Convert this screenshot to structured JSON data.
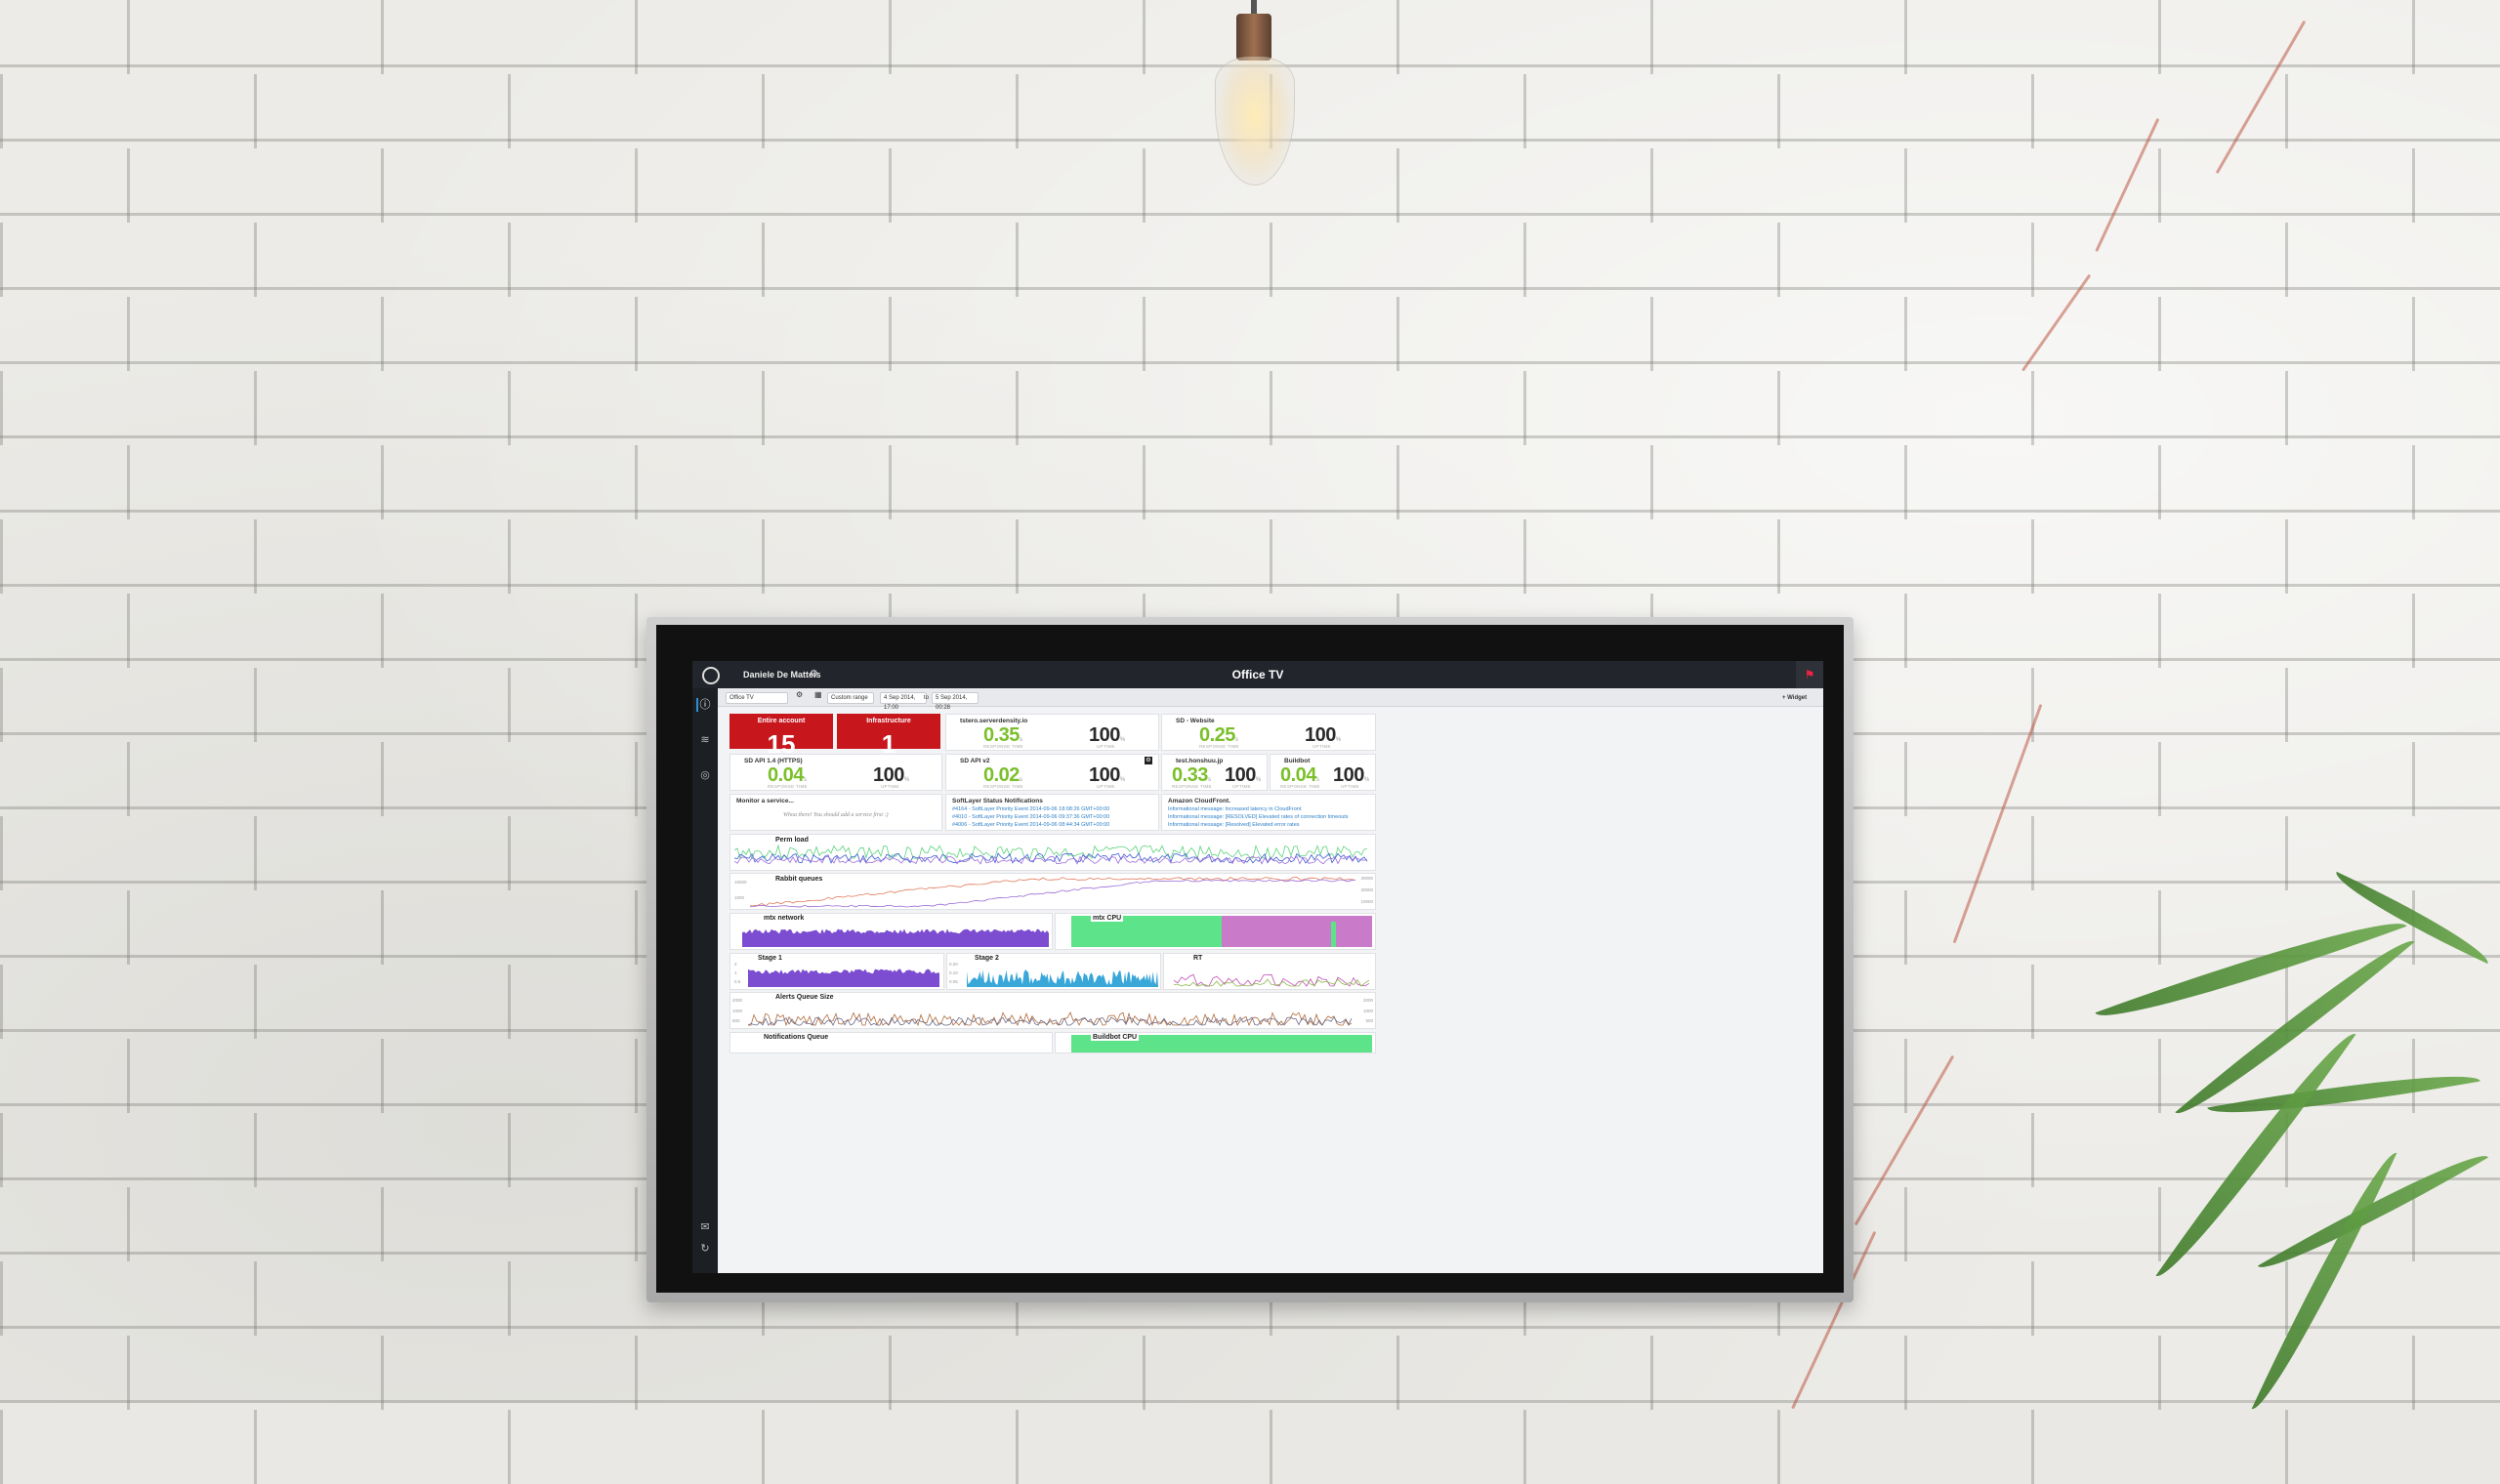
{
  "screen": {
    "user": "Daniele De Mattéis",
    "title": "Office TV",
    "dashboard_select": "Office TV",
    "range_select": "Custom range",
    "range_start": "4 Sep 2014, 17:00",
    "range_to": "to",
    "range_end": "5 Sep 2014, 00:28",
    "add_widget": "+ Widget"
  },
  "alerts": [
    {
      "label": "Entire account",
      "value": "15"
    },
    {
      "label": "Infrastructure",
      "value": "1"
    }
  ],
  "services": [
    {
      "name": "tstero.serverdensity.io",
      "response": "0.35",
      "uptime": "100"
    },
    {
      "name": "SD - Website",
      "response": "0.25",
      "uptime": "100"
    },
    {
      "name": "SD API 1.4 (HTTPS)",
      "response": "0.04",
      "uptime": "100"
    },
    {
      "name": "SD API v2",
      "response": "0.02",
      "uptime": "100"
    },
    {
      "name": "test.honshuu.jp",
      "response": "0.33",
      "uptime": "100"
    },
    {
      "name": "Buildbot",
      "response": "0.04",
      "uptime": "100"
    }
  ],
  "units": {
    "response": "s",
    "uptime": "%",
    "response_label": "RESPONSE TIME",
    "uptime_label": "UPTIME"
  },
  "monitor": {
    "title": "Monitor a service...",
    "hint": "Whoa there! You should add a service first :)"
  },
  "feeds": [
    {
      "title": "SoftLayer Status Notifications",
      "items": [
        "#4164 - SoftLayer Priority Event 2014-09-06 18:08:26 GMT+00:00",
        "#4010 - SoftLayer Priority Event 2014-09-06 09:37:36 GMT+00:00",
        "#4006 - SoftLayer Priority Event 2014-09-06 08:44:34 GMT+00:00"
      ]
    },
    {
      "title": "Amazon CloudFront.",
      "items": [
        "Informational message: Increased latency in CloudFront",
        "Informational message: [RESOLVED] Elevated rates of connection timeouts",
        "Informational message: [Resolved] Elevated error rates"
      ]
    }
  ],
  "charts": [
    {
      "title": "Perm load"
    },
    {
      "title": "Rabbit queues"
    },
    {
      "title": "mtx network"
    },
    {
      "title": "mtx CPU"
    },
    {
      "title": "Stage 1"
    },
    {
      "title": "Stage 2"
    },
    {
      "title": "RT"
    },
    {
      "title": "Alerts Queue Size"
    },
    {
      "title": "Notifications Queue"
    },
    {
      "title": "Buildbot CPU"
    }
  ],
  "ticks": {
    "rabbit": [
      "10000",
      "1000"
    ],
    "rabbit_r": [
      "30000",
      "20000",
      "10000"
    ],
    "alerts": [
      "2000",
      "1000",
      "500"
    ],
    "stage1": [
      "2",
      "1",
      "0.5"
    ],
    "stage2": [
      "0.20",
      "0.10",
      "0.05"
    ]
  },
  "colors": {
    "alert_red": "#c8161d",
    "good_green": "#7bbf2a",
    "link_blue": "#2d7fc7"
  }
}
